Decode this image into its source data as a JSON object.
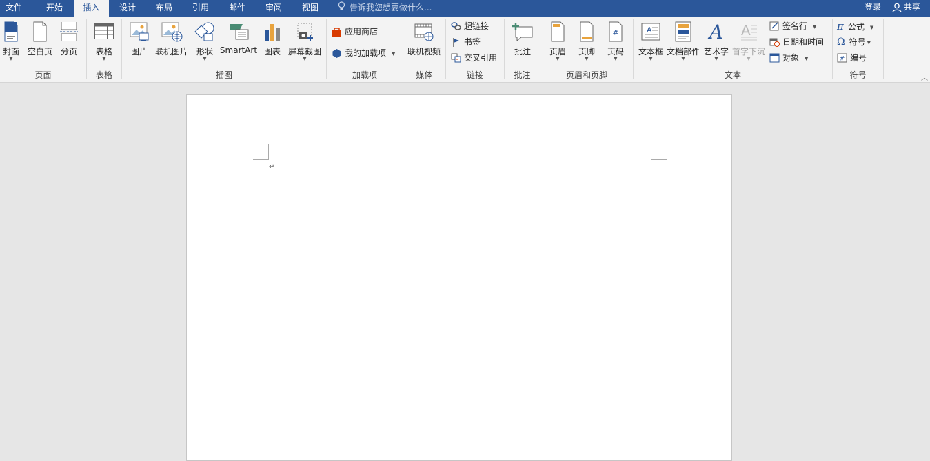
{
  "tabs": [
    "文件",
    "开始",
    "插入",
    "设计",
    "布局",
    "引用",
    "邮件",
    "审阅",
    "视图"
  ],
  "active_tab": "插入",
  "tell_me_placeholder": "告诉我您想要做什么...",
  "account": {
    "login": "登录",
    "share": "共享"
  },
  "groups": {
    "pages": {
      "label": "页面",
      "cover": "封面",
      "blank": "空白页",
      "break": "分页"
    },
    "tables": {
      "label": "表格",
      "table": "表格"
    },
    "illustrations": {
      "label": "插图",
      "pictures": "图片",
      "online_pictures": "联机图片",
      "shapes": "形状",
      "smartart": "SmartArt",
      "chart": "图表",
      "screenshot": "屏幕截图"
    },
    "addins": {
      "label": "加载项",
      "store": "应用商店",
      "my_addins": "我的加载项"
    },
    "media": {
      "label": "媒体",
      "online_video": "联机视频"
    },
    "links": {
      "label": "链接",
      "hyperlink": "超链接",
      "bookmark": "书签",
      "cross_ref": "交叉引用"
    },
    "comments": {
      "label": "批注",
      "comment": "批注"
    },
    "header_footer": {
      "label": "页眉和页脚",
      "header": "页眉",
      "footer": "页脚",
      "page_number": "页码"
    },
    "text": {
      "label": "文本",
      "textbox": "文本框",
      "quick_parts": "文档部件",
      "wordart": "艺术字",
      "dropcap": "首字下沉",
      "signature": "签名行",
      "datetime": "日期和时间",
      "object": "对象"
    },
    "symbols": {
      "label": "符号",
      "equation": "公式",
      "symbol": "符号",
      "number": "编号"
    }
  },
  "document": {
    "paragraph_mark": "↵"
  },
  "colors": {
    "accent": "#2b579a",
    "ribbon_bg": "#f3f3f3",
    "workspace_bg": "#e6e6e6"
  }
}
